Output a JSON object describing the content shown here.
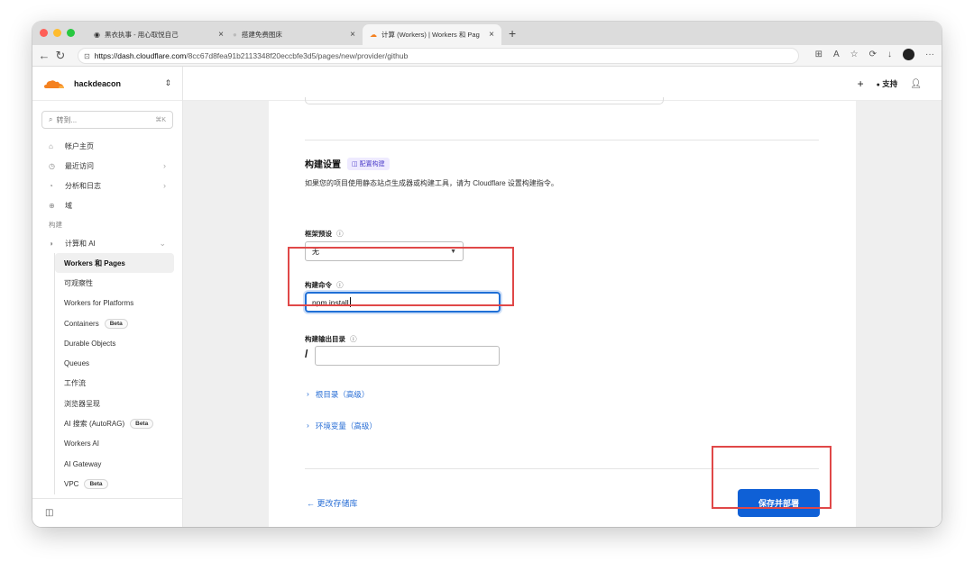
{
  "browser": {
    "tabs": [
      {
        "title": "黑衣执事 - 用心取悦自己"
      },
      {
        "title": "搭建免费图床"
      },
      {
        "title": "计算 (Workers) | Workers 和 Pag"
      }
    ],
    "url_host": "https://dash.cloudflare.com",
    "url_path": "/8cc67d8fea91b2113348f20eccbfe3d5/pages/new/provider/github"
  },
  "sidebar": {
    "account": "hackdeacon",
    "search_placeholder": "转到...",
    "search_shortcut": "⌘K",
    "items": [
      {
        "label": "帐户主页",
        "icon": "home-icon"
      },
      {
        "label": "最近访问",
        "icon": "clock-icon"
      },
      {
        "label": "分析和日志",
        "icon": "chart-icon"
      },
      {
        "label": "域",
        "icon": "globe-icon"
      }
    ],
    "section_build": "构建",
    "compute": "计算和 AI",
    "sub_items": [
      {
        "label": "Workers 和 Pages",
        "badge": ""
      },
      {
        "label": "可观察性",
        "badge": ""
      },
      {
        "label": "Workers for Platforms",
        "badge": ""
      },
      {
        "label": "Containers",
        "badge": "Beta"
      },
      {
        "label": "Durable Objects",
        "badge": ""
      },
      {
        "label": "Queues",
        "badge": ""
      },
      {
        "label": "工作流",
        "badge": ""
      },
      {
        "label": "浏览器呈现",
        "badge": ""
      },
      {
        "label": "AI 搜索 (AutoRAG)",
        "badge": "Beta"
      },
      {
        "label": "Workers AI",
        "badge": ""
      },
      {
        "label": "AI Gateway",
        "badge": ""
      },
      {
        "label": "VPC",
        "badge": "Beta"
      }
    ]
  },
  "topbar": {
    "plus": "+",
    "support": "支持"
  },
  "build": {
    "title": "构建设置",
    "config_link": "配置构建",
    "description": "如果您的项目使用静态站点生成器或构建工具，请为 Cloudflare 设置构建指令。",
    "preset_label": "框架预设",
    "preset_value": "无",
    "command_label": "构建命令",
    "command_value": "npm install",
    "output_label": "构建输出目录",
    "output_prefix": "/",
    "output_value": "",
    "root_dir": "根目录（高级）",
    "env_vars": "环境变量（高级）",
    "back": "← 更改存储库",
    "deploy": "保存并部署"
  },
  "colors": {
    "accent": "#0f60d6",
    "annotation": "#e04848",
    "cloudflare_orange": "#f48120"
  }
}
